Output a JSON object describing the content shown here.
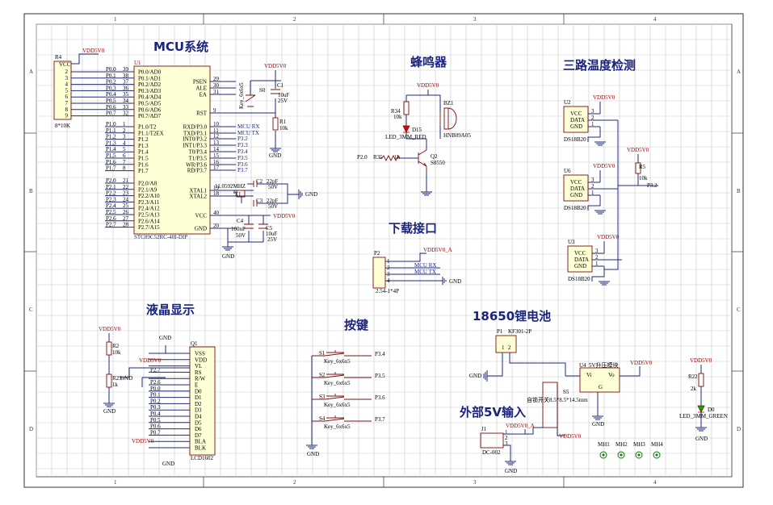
{
  "frame": {
    "columns": [
      "1",
      "2",
      "3",
      "4"
    ],
    "rows": [
      "A",
      "B",
      "C",
      "D"
    ]
  },
  "sections": {
    "mcu": "MCU系统",
    "buzzer": "蜂鸣器",
    "temp": "三路温度检测",
    "download": "下载接口",
    "lcd": "液晶显示",
    "keys": "按键",
    "battery": "18650锂电池",
    "ext5v": "外部5V输入"
  },
  "power": {
    "vdd": "VDD5V0",
    "vdd_a": "VDD5V0_A",
    "gnd": "GND"
  },
  "mcu": {
    "ref": "U1",
    "part": "STC89C52RC-40I-DIP",
    "pins_left": [
      {
        "num": "39",
        "name": "P0.0/AD0",
        "net": "P0.0"
      },
      {
        "num": "38",
        "name": "P0.1/AD1",
        "net": "P0.1"
      },
      {
        "num": "37",
        "name": "P0.2/AD2",
        "net": "P0.2"
      },
      {
        "num": "36",
        "name": "P0.3/AD3",
        "net": "P0.3"
      },
      {
        "num": "35",
        "name": "P0.4/AD4",
        "net": "P0.4"
      },
      {
        "num": "34",
        "name": "P0.5/AD5",
        "net": "P0.5"
      },
      {
        "num": "33",
        "name": "P0.6/AD6",
        "net": "P0.6"
      },
      {
        "num": "32",
        "name": "P0.7/AD7",
        "net": "P0.7"
      },
      {
        "num": "1",
        "name": "P1.0/T2",
        "net": "P1.0"
      },
      {
        "num": "2",
        "name": "P1.1/T2EX",
        "net": "P1.1"
      },
      {
        "num": "3",
        "name": "P1.2",
        "net": "P1.2"
      },
      {
        "num": "4",
        "name": "P1.3",
        "net": "P1.3"
      },
      {
        "num": "5",
        "name": "P1.4",
        "net": "P1.4"
      },
      {
        "num": "6",
        "name": "P1.5",
        "net": "P1.5"
      },
      {
        "num": "7",
        "name": "P1.6",
        "net": "P1.6"
      },
      {
        "num": "8",
        "name": "P1.7",
        "net": "P1.7"
      },
      {
        "num": "21",
        "name": "P2.0/A8",
        "net": "P2.0"
      },
      {
        "num": "22",
        "name": "P2.1/A9",
        "net": "P2.1"
      },
      {
        "num": "23",
        "name": "P2.2/A10",
        "net": "P2.2"
      },
      {
        "num": "24",
        "name": "P2.3/A11",
        "net": "P2.3"
      },
      {
        "num": "25",
        "name": "P2.4/A12",
        "net": "P2.4"
      },
      {
        "num": "26",
        "name": "P2.5/A13",
        "net": "P2.5"
      },
      {
        "num": "27",
        "name": "P2.6/A14",
        "net": "P2.6"
      },
      {
        "num": "28",
        "name": "P2.7/A15",
        "net": "P2.7"
      }
    ],
    "pins_right": [
      {
        "num": "29",
        "name": "PSEN",
        "net": ""
      },
      {
        "num": "30",
        "name": "ALE",
        "net": ""
      },
      {
        "num": "31",
        "name": "EA",
        "net": ""
      },
      {
        "num": "9",
        "name": "RST",
        "net": ""
      },
      {
        "num": "10",
        "name": "RXD/P3.0",
        "net": "MCU RX"
      },
      {
        "num": "11",
        "name": "TXD/P3.1",
        "net": "MCU TX"
      },
      {
        "num": "12",
        "name": "INT0/P3.2",
        "net": "P3.2"
      },
      {
        "num": "13",
        "name": "INT1/P3.3",
        "net": "P3.3"
      },
      {
        "num": "14",
        "name": "T0/P3.4",
        "net": "P3.4"
      },
      {
        "num": "15",
        "name": "T1/P3.5",
        "net": "P3.5"
      },
      {
        "num": "16",
        "name": "WR/P3.6",
        "net": "P3.6"
      },
      {
        "num": "17",
        "name": "RD/P3.7",
        "net": "P3.7"
      },
      {
        "num": "19",
        "name": "XTAL1",
        "net": ""
      },
      {
        "num": "18",
        "name": "XTAL2",
        "net": ""
      },
      {
        "num": "40",
        "name": "VCC",
        "net": ""
      },
      {
        "num": "20",
        "name": "GND",
        "net": ""
      }
    ]
  },
  "rpack": {
    "ref": "R4",
    "value": "8*10K",
    "pin_vcc": "VCC",
    "pins": [
      "2",
      "3",
      "4",
      "5",
      "6",
      "7",
      "8",
      "9"
    ]
  },
  "reset": {
    "switch_ref": "S0",
    "switch_part": "Key_6x6x5",
    "cap_ref": "C1",
    "cap_value": "10uF",
    "cap_volt": "25V",
    "res_ref": "R1",
    "res_value": "10k"
  },
  "crystal": {
    "ref": "X1",
    "freq": "11.0592MHZ",
    "c2_ref": "C2",
    "c2_value": "22pF",
    "c2_volt": "50V",
    "c3_ref": "C3",
    "c3_value": "22pF",
    "c3_volt": "50V"
  },
  "decoupling": {
    "c4_ref": "C4",
    "c4_value": "100nF",
    "c4_volt": "50V",
    "c5_ref": "C5",
    "c5_value": "10uF",
    "c5_volt": "25V"
  },
  "buzzer": {
    "r34_ref": "R34",
    "r34_value": "10k",
    "bz_ref": "BZ1",
    "bz_part": "HNB09A05",
    "led_ref": "D15",
    "led_part": "LED_3MM_RED",
    "q_ref": "Q2",
    "q_part": "S8550",
    "r35_ref": "R35",
    "r35_value": "1k",
    "net_in": "P2.0"
  },
  "sensors": {
    "items": [
      {
        "ref": "U2",
        "part": "DS18B20"
      },
      {
        "ref": "U6",
        "part": "DS18B20"
      },
      {
        "ref": "U3",
        "part": "DS18B20"
      }
    ],
    "pins": [
      "VCC",
      "DATA",
      "GND"
    ],
    "pin_nums": [
      "3",
      "2",
      "1"
    ],
    "r5_ref": "R5",
    "r5_value": "10k",
    "net": "P3.2"
  },
  "download": {
    "ref": "P2",
    "part": "2.54-1*4P",
    "nets": [
      "MCU RX",
      "MCU TX"
    ],
    "pin_nums": [
      "1",
      "2",
      "3",
      "4"
    ]
  },
  "lcd": {
    "ref": "Q1",
    "part": "LCD1602",
    "pins": [
      "VSS",
      "VDD",
      "VL",
      "RS",
      "R/W",
      "E",
      "D0",
      "D1",
      "D2",
      "D3",
      "D4",
      "D5",
      "D6",
      "D7",
      "BLA",
      "BLK"
    ],
    "nets": [
      "",
      "",
      "",
      "P2.7",
      "",
      "P2.6",
      "P0.0",
      "P0.1",
      "P0.2",
      "P0.3",
      "P0.4",
      "P0.5",
      "P0.6",
      "P0.7",
      "",
      ""
    ],
    "r2_ref": "R2",
    "r2_value": "10k",
    "r23_ref": "R23",
    "r23_value": "1k"
  },
  "keys": {
    "items": [
      {
        "ref": "S1",
        "part": "Key_6x6x5",
        "net": "P3.4"
      },
      {
        "ref": "S2",
        "part": "Key_6x6x5",
        "net": "P3.5"
      },
      {
        "ref": "S3",
        "part": "Key_6x6x5",
        "net": "P3.6"
      },
      {
        "ref": "S4",
        "part": "Key_6x6x5",
        "net": "P3.7"
      }
    ]
  },
  "battery": {
    "ref": "P1",
    "part": "KF301-2P",
    "pins": [
      "1",
      "2"
    ]
  },
  "boost": {
    "ref": "U4",
    "part": "5V升压模块",
    "pin_in": "Vi",
    "pin_out": "Vo",
    "pin_gnd": "G"
  },
  "selfswitch": {
    "ref": "S5",
    "part": "自锁开关8.5*8.5*14.5mm"
  },
  "dc": {
    "ref": "J1",
    "part": "DC-002",
    "pins": [
      "1",
      "2",
      "3"
    ]
  },
  "power_led": {
    "r_ref": "R22",
    "r_value": "2k",
    "led_ref": "D0",
    "led_part": "LED_3MM_GREEN"
  },
  "holes": [
    "MH1",
    "MH2",
    "MH3",
    "MH4"
  ],
  "colors": {
    "wire": "#1f2a7a",
    "part": "#7a1010",
    "body": "#ffffd6",
    "title": "#1a237e",
    "grid": "#c9c9c9",
    "led_red": "#e00000",
    "led_green": "#00b000"
  }
}
